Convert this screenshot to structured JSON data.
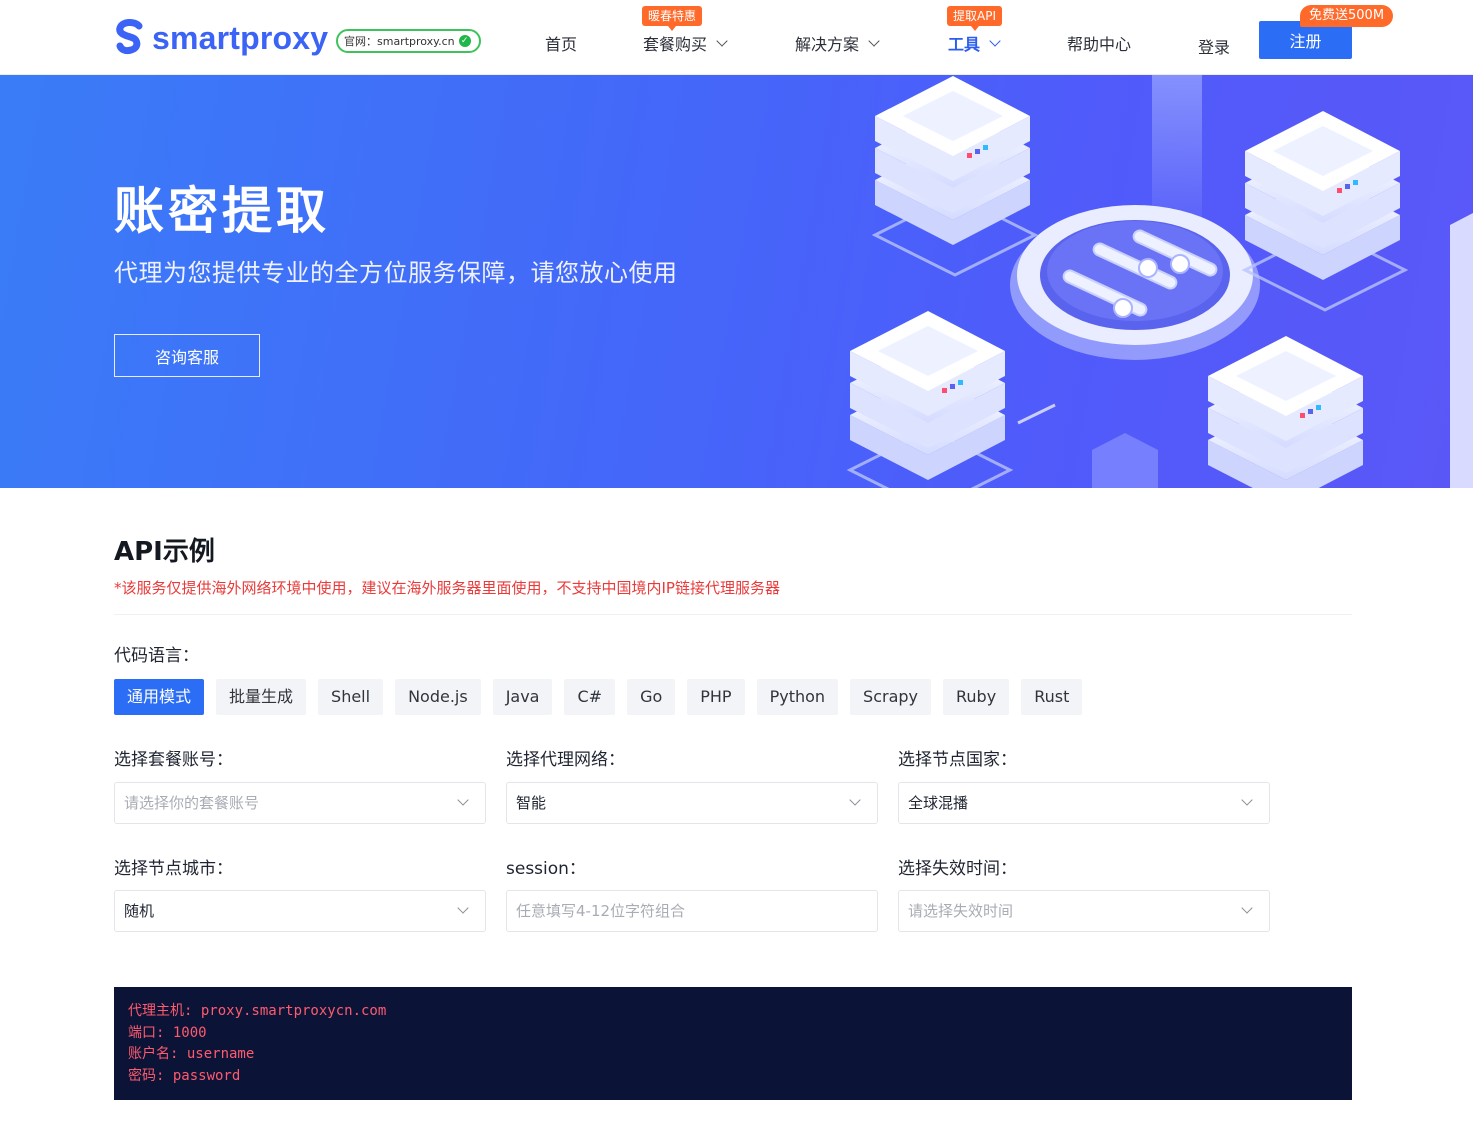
{
  "nav": {
    "logo_text": "smartproxy",
    "official_label": "官网：smartproxy.cn",
    "items": [
      {
        "label": "首页"
      },
      {
        "label": "套餐购买",
        "badge": "暖春特惠"
      },
      {
        "label": "解决方案"
      },
      {
        "label": "工具",
        "badge": "提取API"
      },
      {
        "label": "帮助中心"
      },
      {
        "label": "登录"
      }
    ],
    "register": "注册",
    "register_badge": "免费送500M"
  },
  "hero": {
    "title": "账密提取",
    "subtitle": "代理为您提供专业的全方位服务保障，请您放心使用",
    "button": "咨询客服"
  },
  "api": {
    "title": "API示例",
    "note": "*该服务仅提供海外网络环境中使用，建议在海外服务器里面使用，不支持中国境内IP链接代理服务器",
    "lang_label": "代码语言：",
    "langs": [
      "通用模式",
      "批量生成",
      "Shell",
      "Node.js",
      "Java",
      "C#",
      "Go",
      "PHP",
      "Python",
      "Scrapy",
      "Ruby",
      "Rust"
    ],
    "active_lang": "通用模式",
    "fields": {
      "account": {
        "label": "选择套餐账号：",
        "placeholder": "请选择你的套餐账号"
      },
      "network": {
        "label": "选择代理网络：",
        "value": "智能"
      },
      "country": {
        "label": "选择节点国家：",
        "value": "全球混播"
      },
      "city": {
        "label": "选择节点城市：",
        "value": "随机"
      },
      "session": {
        "label": "session：",
        "placeholder": "任意填写4-12位字符组合"
      },
      "expire": {
        "label": "选择失效时间：",
        "placeholder": "请选择失效时间"
      }
    },
    "code": [
      "代理主机: proxy.smartproxycn.com",
      "端口: 1000",
      "账户名: username",
      "密码: password"
    ]
  },
  "colors": {
    "accent": "#2b6df5",
    "badge": "#ff6a2b",
    "note": "#ea3a3a",
    "code_bg": "#0b1437",
    "code_text": "#ff5a6e"
  }
}
